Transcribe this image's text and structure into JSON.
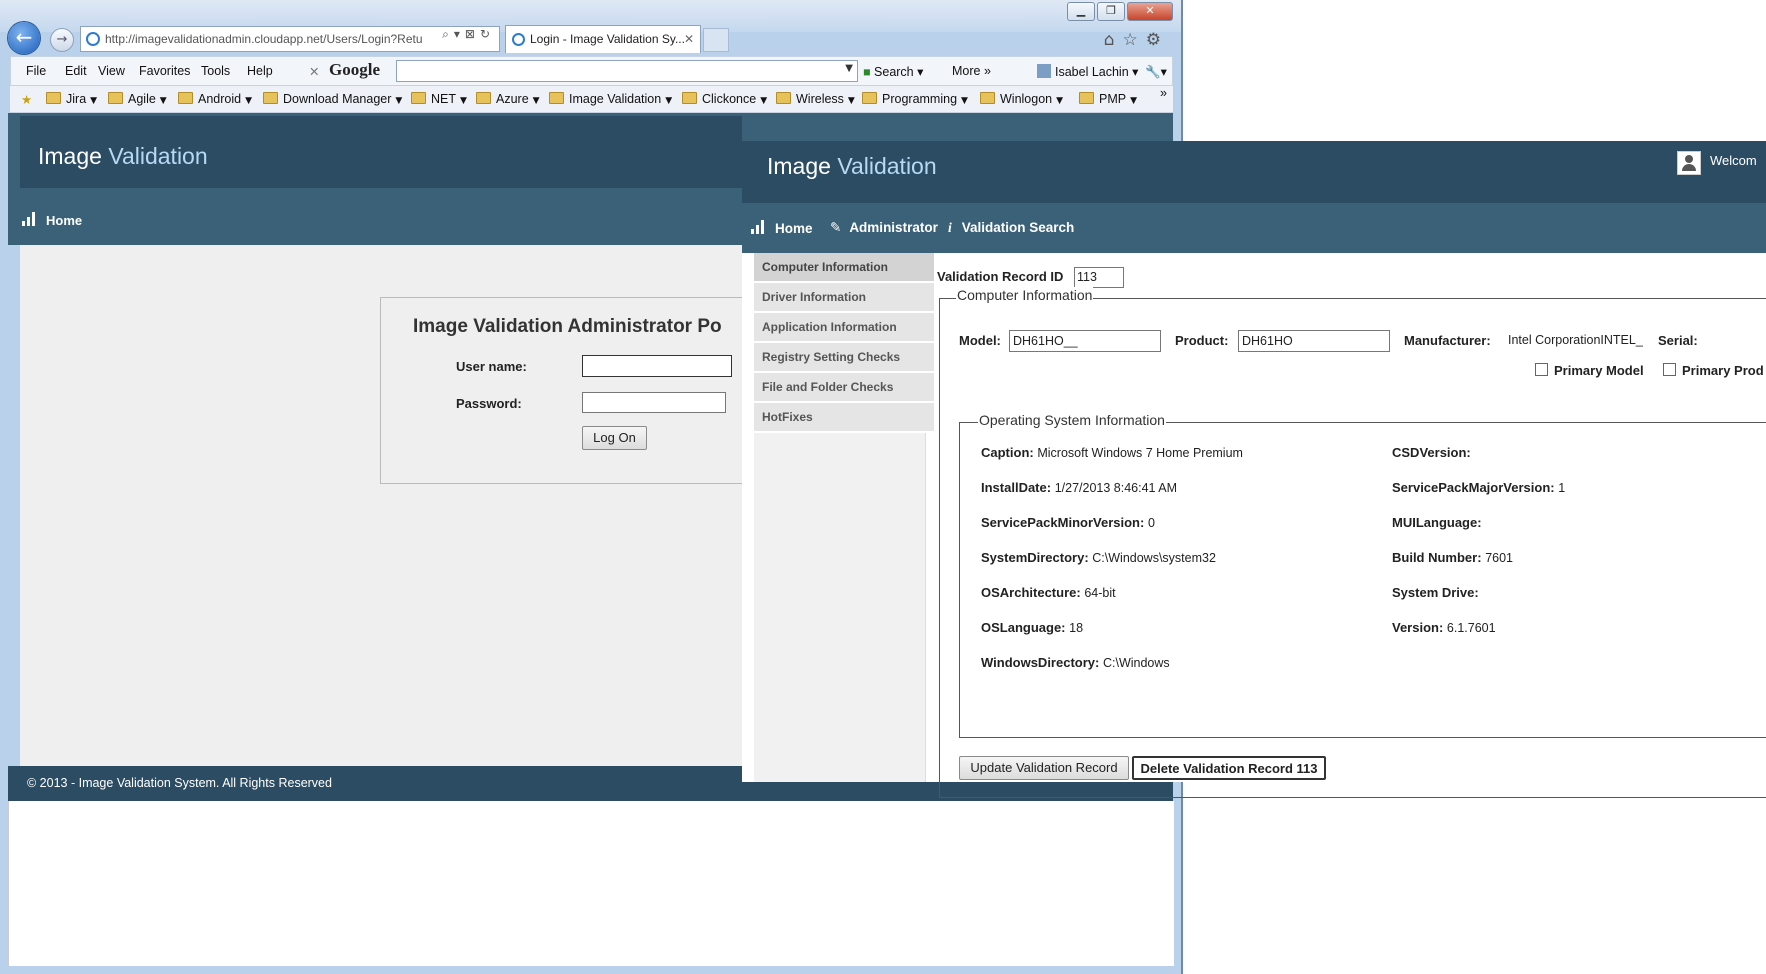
{
  "browser": {
    "window_buttons": {
      "minimize": "▁",
      "restore": "❐",
      "close": "✕"
    },
    "address": "http://imagevalidationadmin.cloudapp.net/Users/Login?Retu",
    "tab_title": "Login - Image Validation Sy...",
    "tab_close": "✕",
    "menu": [
      "File",
      "Edit",
      "View",
      "Favorites",
      "Tools",
      "Help"
    ],
    "google_label": "Google",
    "search_label": "Search",
    "more_label": "More »",
    "user_label": "Isabel Lachin",
    "favorites": [
      "Jira",
      "Agile",
      "Android",
      "Download Manager",
      "NET",
      "Azure",
      "Image Validation",
      "Clickonce",
      "Wireless",
      "Programming",
      "Winlogon",
      "PMP"
    ],
    "overflow": "»"
  },
  "login_page": {
    "logo_left": "Image ",
    "logo_right": "Validation",
    "nav_home": "Home",
    "heading": "Image Validation Administrator Po",
    "username_label": "User name:",
    "password_label": "Password:",
    "logon_button": "Log On",
    "footer": "© 2013 - Image Validation System. All Rights Reserved"
  },
  "app": {
    "logo_left": "Image ",
    "logo_right": "Validation",
    "welcome": "Welcom",
    "nav": {
      "home": "Home",
      "admin": "Administrator",
      "search": "Validation Search"
    },
    "sidebar": [
      "Computer Information",
      "Driver Information",
      "Application Information",
      "Registry Setting Checks",
      "File and Folder Checks",
      "HotFixes"
    ],
    "record_id_label": "Validation Record ID",
    "record_id_value": "113",
    "computer_legend": "Computer Information",
    "model_label": "Model:",
    "model_value": "DH61HO__",
    "product_label": "Product:",
    "product_value": "DH61HO",
    "manufacturer_label": "Manufacturer:",
    "manufacturer_value": "Intel CorporationINTEL_",
    "serial_label": "Serial:",
    "primary_model_label": "Primary Model",
    "primary_product_label": "Primary Prod",
    "os_legend": "Operating System Information",
    "os_left": [
      {
        "label": "Caption:",
        "value": "Microsoft Windows 7 Home Premium"
      },
      {
        "label": "InstallDate:",
        "value": "1/27/2013 8:46:41 AM"
      },
      {
        "label": "ServicePackMinorVersion:",
        "value": "0"
      },
      {
        "label": "SystemDirectory:",
        "value": "C:\\Windows\\system32"
      },
      {
        "label": "OSArchitecture:",
        "value": "64-bit"
      },
      {
        "label": "OSLanguage:",
        "value": "18"
      },
      {
        "label": "WindowsDirectory:",
        "value": "C:\\Windows"
      }
    ],
    "os_right": [
      {
        "label": "CSDVersion:",
        "value": ""
      },
      {
        "label": "ServicePackMajorVersion:",
        "value": "1"
      },
      {
        "label": "MUILanguage:",
        "value": ""
      },
      {
        "label": "Build Number:",
        "value": "7601"
      },
      {
        "label": "System Drive:",
        "value": ""
      },
      {
        "label": "Version:",
        "value": "6.1.7601"
      }
    ],
    "update_button": "Update Validation Record",
    "delete_button": "Delete Validation Record 113"
  }
}
